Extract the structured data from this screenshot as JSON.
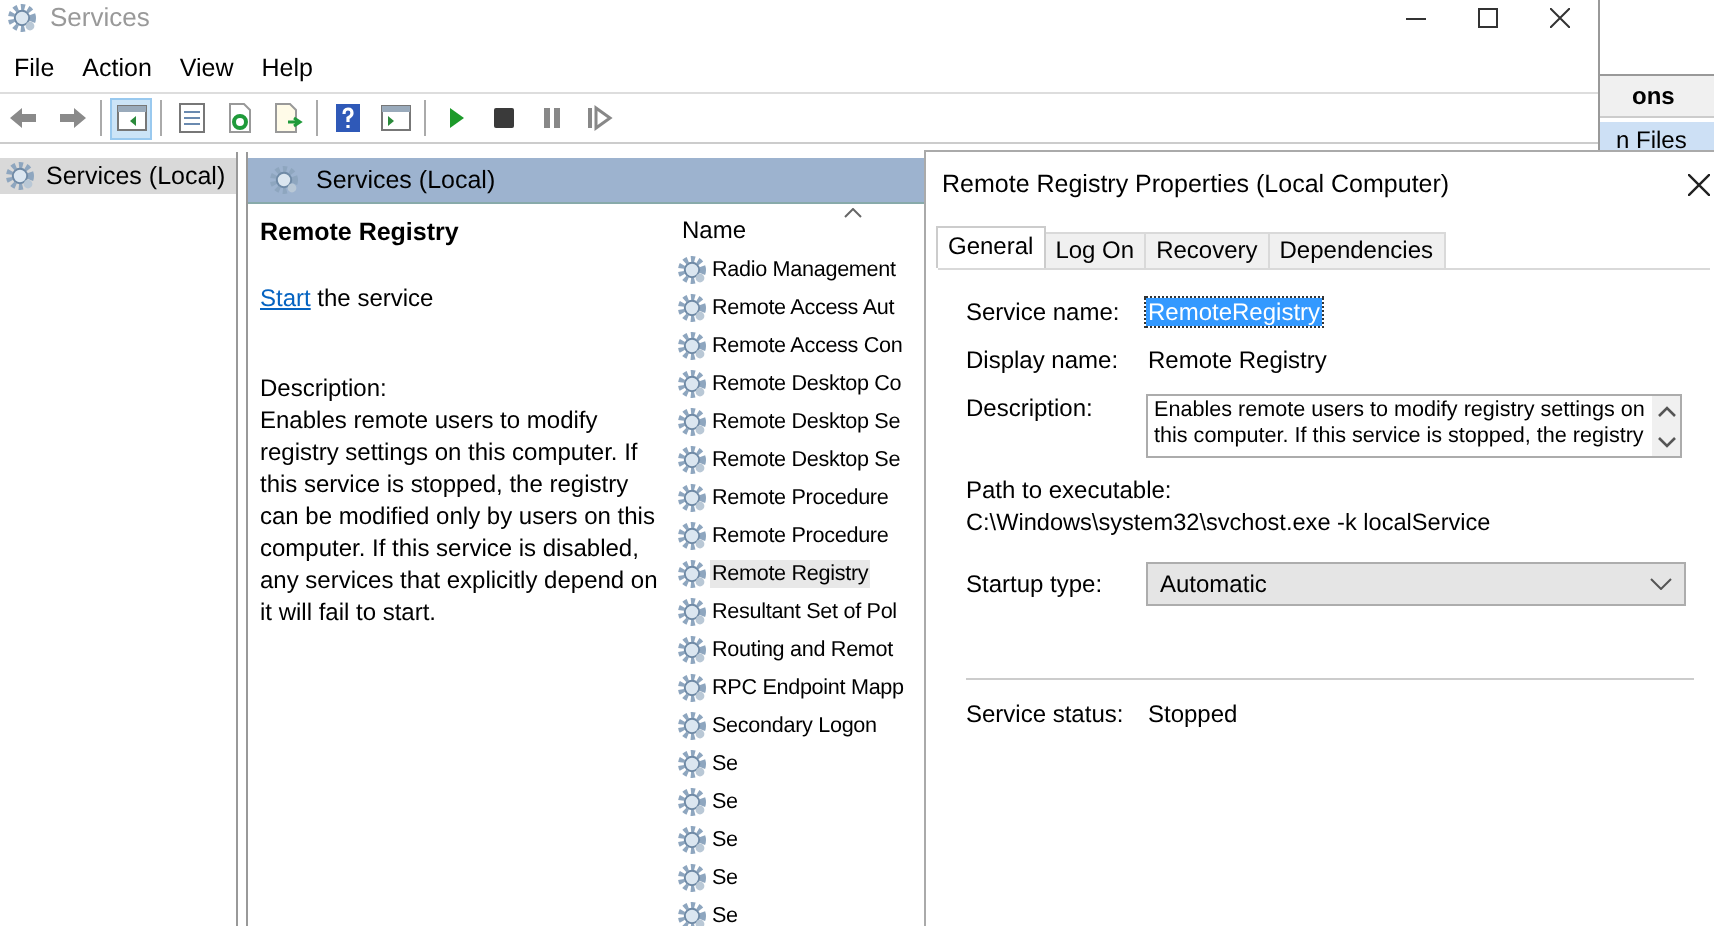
{
  "window": {
    "title": "Services"
  },
  "menu": [
    "File",
    "Action",
    "View",
    "Help"
  ],
  "tree": {
    "items": [
      {
        "label": "Services (Local)",
        "selected": true
      }
    ]
  },
  "pane": {
    "title": "Services (Local)"
  },
  "details": {
    "service": "Remote Registry",
    "action_link": "Start",
    "action_text": "the service",
    "description_label": "Description:",
    "description": "Enables remote users to modify registry settings on this computer. If this service is stopped, the registry can be modified only by users on this computer. If this service is disabled, any services that explicitly depend on it will fail to start."
  },
  "list": {
    "columns": [
      {
        "label": "Name",
        "sorted": true
      }
    ],
    "rows": [
      {
        "name": "Radio Management",
        "selected": false
      },
      {
        "name": "Remote Access Aut",
        "selected": false
      },
      {
        "name": "Remote Access Con",
        "selected": false
      },
      {
        "name": "Remote Desktop Co",
        "selected": false
      },
      {
        "name": "Remote Desktop Se",
        "selected": false
      },
      {
        "name": "Remote Desktop Se",
        "selected": false
      },
      {
        "name": "Remote Procedure",
        "selected": false
      },
      {
        "name": "Remote Procedure",
        "selected": false
      },
      {
        "name": "Remote Registry",
        "selected": true
      },
      {
        "name": "Resultant Set of Pol",
        "selected": false
      },
      {
        "name": "Routing and Remot",
        "selected": false
      },
      {
        "name": "RPC Endpoint Mapp",
        "selected": false
      },
      {
        "name": "Secondary Logon",
        "selected": false
      },
      {
        "name": "Se",
        "selected": false
      },
      {
        "name": "Se",
        "selected": false
      },
      {
        "name": "Se",
        "selected": false
      },
      {
        "name": "Se",
        "selected": false
      },
      {
        "name": "Se",
        "selected": false
      }
    ]
  },
  "background_window": {
    "column_header": "ons",
    "row": "n Files"
  },
  "dialog": {
    "title": "Remote Registry Properties (Local Computer)",
    "tabs": [
      {
        "label": "General",
        "selected": true
      },
      {
        "label": "Log On",
        "selected": false
      },
      {
        "label": "Recovery",
        "selected": false
      },
      {
        "label": "Dependencies",
        "selected": false
      }
    ],
    "fields": [
      {
        "kind": "text",
        "label": "Service name:",
        "value": "RemoteRegistry",
        "highlighted": true
      },
      {
        "kind": "text",
        "label": "Display name:",
        "value": "Remote Registry",
        "highlighted": false
      },
      {
        "kind": "memo",
        "label": "Description:",
        "value": "Enables remote users to modify registry settings on this computer. If this service is stopped, the registry"
      },
      {
        "kind": "path",
        "label": "Path to executable:",
        "value": "C:\\Windows\\system32\\svchost.exe -k localService"
      },
      {
        "kind": "dropdown",
        "label": "Startup type:",
        "value": "Automatic"
      },
      {
        "kind": "status",
        "label": "Service status:",
        "value": "Stopped"
      }
    ]
  }
}
